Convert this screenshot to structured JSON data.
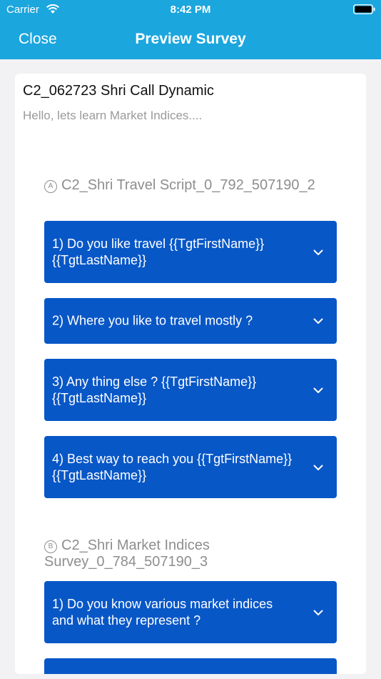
{
  "status_bar": {
    "carrier": "Carrier",
    "time": "8:42 PM"
  },
  "nav": {
    "close_label": "Close",
    "title": "Preview Survey"
  },
  "survey": {
    "title": "C2_062723 Shri Call Dynamic",
    "subtitle": "Hello, lets learn Market Indices....",
    "sections": [
      {
        "letter": "A",
        "name": "C2_Shri Travel Script_0_792_507190_2",
        "questions": [
          "1) Do you like travel {{TgtFirstName}} {{TgtLastName}}",
          "2) Where you like to travel mostly ?",
          "3) Any thing else ? {{TgtFirstName}} {{TgtLastName}}",
          "4) Best way to reach you {{TgtFirstName}}{{TgtLastName}}"
        ]
      },
      {
        "letter": "B",
        "name": "C2_Shri Market Indices Survey_0_784_507190_3",
        "questions": [
          "1) Do you know various market indices and what they represent ?"
        ]
      }
    ]
  },
  "colors": {
    "header": "#1ba6de",
    "question_box": "#0857c7",
    "background": "#f2f2f4"
  }
}
